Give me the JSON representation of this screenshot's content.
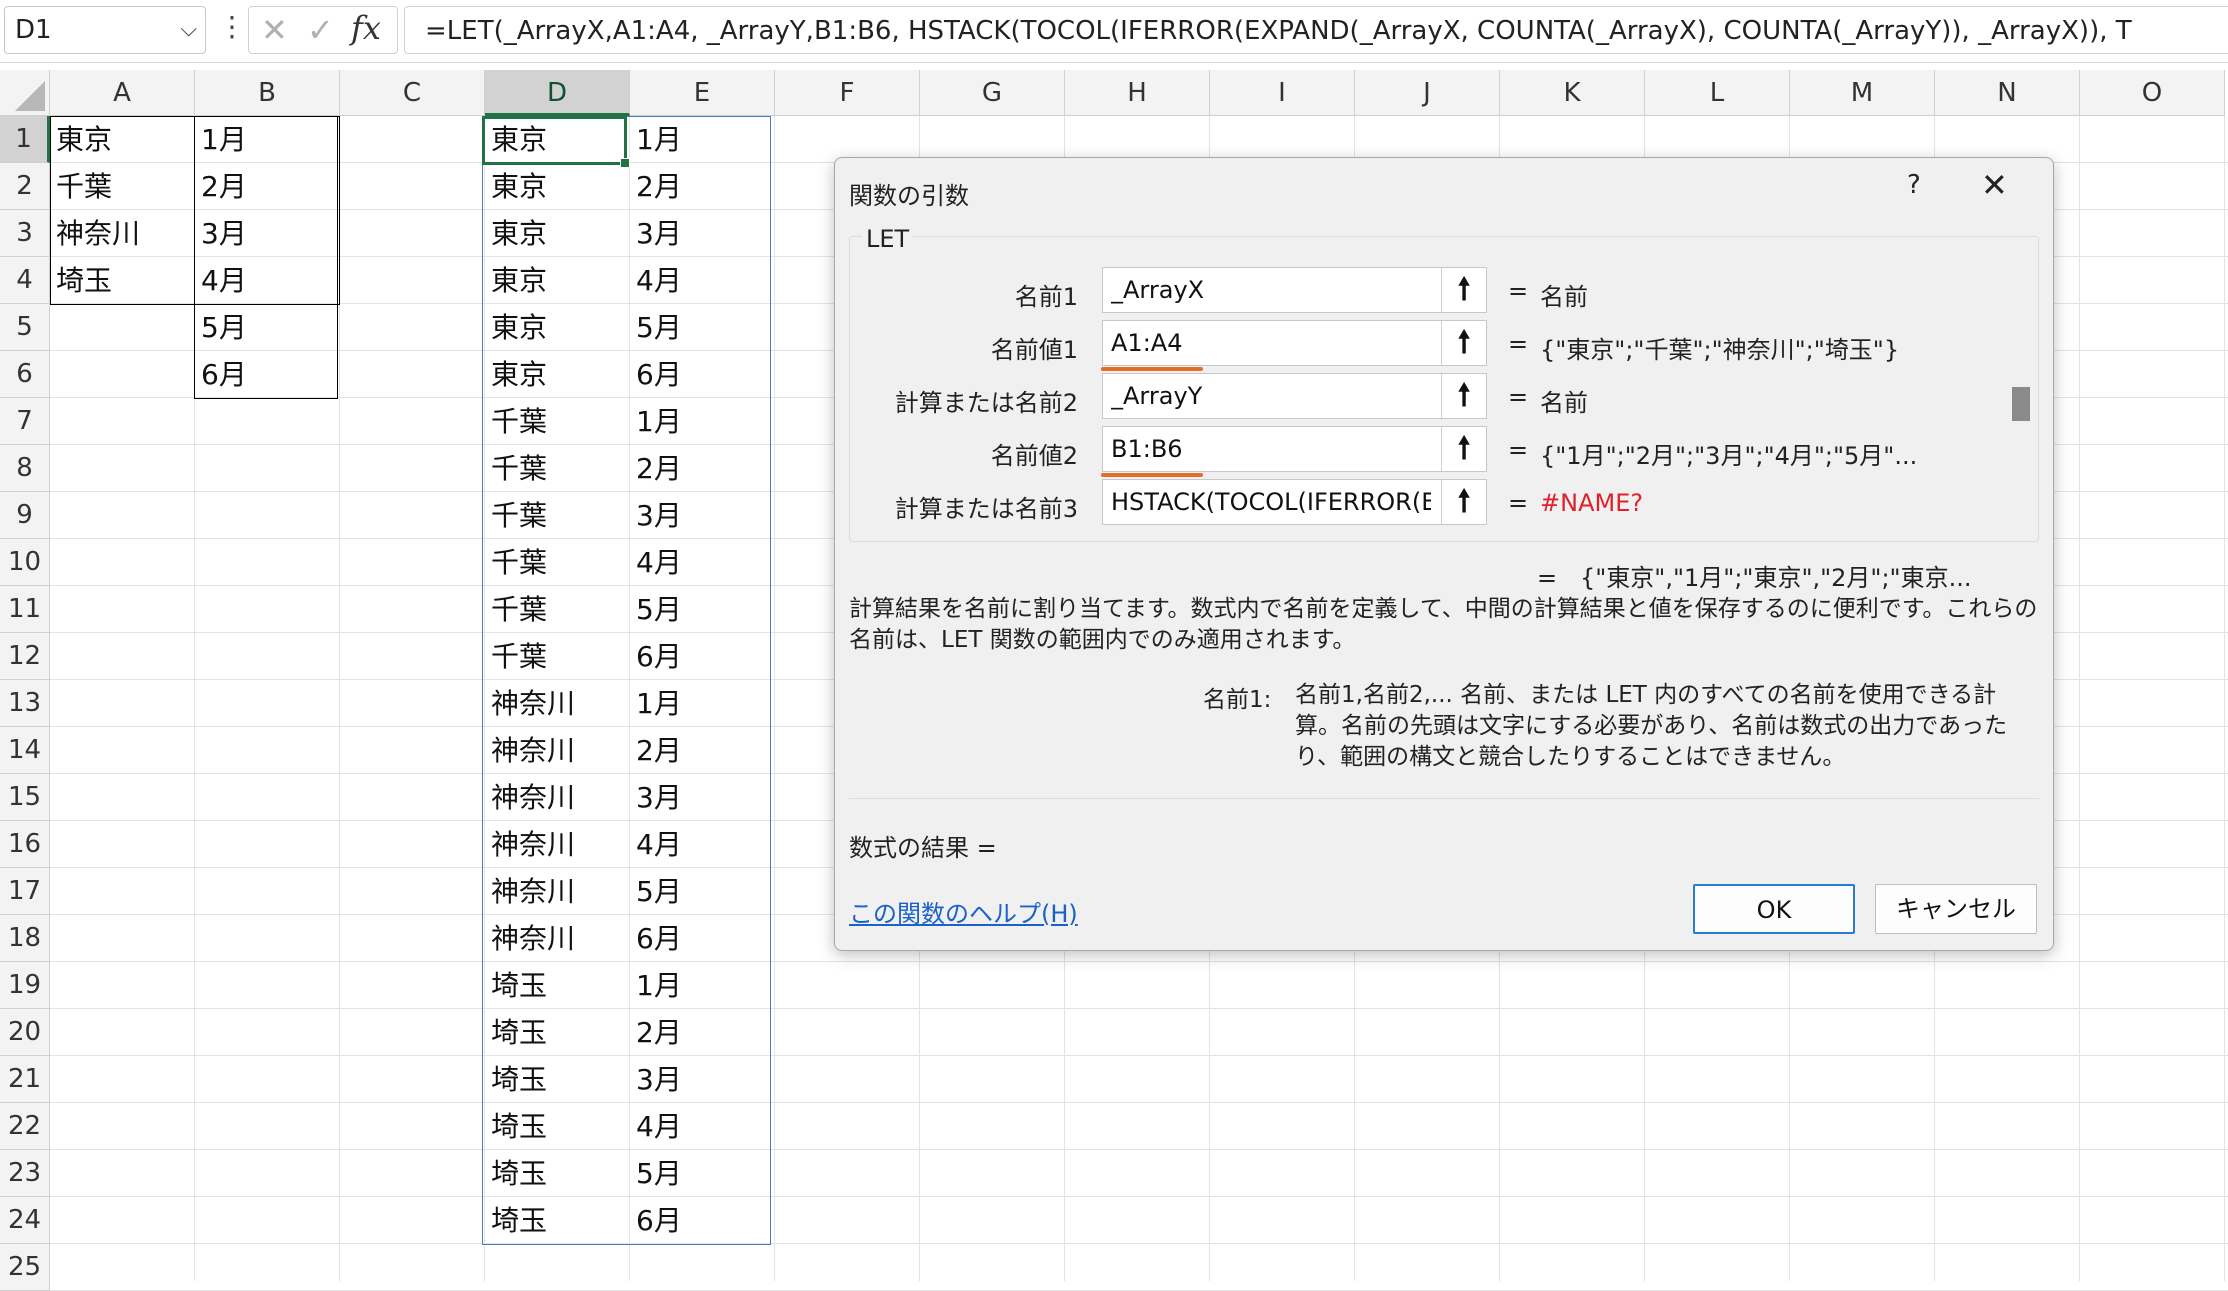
{
  "formula_bar": {
    "name_box": "D1",
    "formula": "=LET(_ArrayX,A1:A4, _ArrayY,B1:B6, HSTACK(TOCOL(IFERROR(EXPAND(_ArrayX, COUNTA(_ArrayX), COUNTA(_ArrayY)), _ArrayX)), T"
  },
  "columns": [
    "A",
    "B",
    "C",
    "D",
    "E",
    "F",
    "G",
    "H",
    "I",
    "J",
    "K",
    "L",
    "M",
    "N",
    "O"
  ],
  "rows": [
    "1",
    "2",
    "3",
    "4",
    "5",
    "6",
    "7",
    "8",
    "9",
    "10",
    "11",
    "12",
    "13",
    "14",
    "15",
    "16",
    "17",
    "18",
    "19",
    "20",
    "21",
    "22",
    "23",
    "24",
    "25"
  ],
  "col_a": [
    "東京",
    "千葉",
    "神奈川",
    "埼玉"
  ],
  "col_b": [
    "1月",
    "2月",
    "3月",
    "4月",
    "5月",
    "6月"
  ],
  "col_d": [
    "東京",
    "東京",
    "東京",
    "東京",
    "東京",
    "東京",
    "千葉",
    "千葉",
    "千葉",
    "千葉",
    "千葉",
    "千葉",
    "神奈川",
    "神奈川",
    "神奈川",
    "神奈川",
    "神奈川",
    "神奈川",
    "埼玉",
    "埼玉",
    "埼玉",
    "埼玉",
    "埼玉",
    "埼玉"
  ],
  "col_e": [
    "1月",
    "2月",
    "3月",
    "4月",
    "5月",
    "6月",
    "1月",
    "2月",
    "3月",
    "4月",
    "5月",
    "6月",
    "1月",
    "2月",
    "3月",
    "4月",
    "5月",
    "6月",
    "1月",
    "2月",
    "3月",
    "4月",
    "5月",
    "6月"
  ],
  "dialog": {
    "title": "関数の引数",
    "help_icon": "?",
    "close_icon": "✕",
    "function_name": "LET",
    "args": [
      {
        "label": "名前1",
        "value": "_ArrayX",
        "eq": "=",
        "result": "名前",
        "error": false
      },
      {
        "label": "名前値1",
        "value": "A1:A4",
        "eq": "=",
        "result": "{\"東京\";\"千葉\";\"神奈川\";\"埼玉\"}",
        "error": false
      },
      {
        "label": "計算または名前2",
        "value": "_ArrayY",
        "eq": "=",
        "result": "名前",
        "error": false
      },
      {
        "label": "名前値2",
        "value": "B1:B6",
        "eq": "=",
        "result": "{\"1月\";\"2月\";\"3月\";\"4月\";\"5月\"...",
        "error": false
      },
      {
        "label": "計算または名前3",
        "value": "HSTACK(TOCOL(IFERROR(EXP",
        "eq": "=",
        "result": "#NAME?",
        "error": true
      }
    ],
    "total_eq": "=",
    "total_result": "{\"東京\",\"1月\";\"東京\",\"2月\";\"東京...",
    "description": "計算結果を名前に割り当てます。数式内で名前を定義して、中間の計算結果と値を保存するのに便利です。これらの名前は、LET 関数の範囲内でのみ適用されます。",
    "arg_desc_label": "名前1:",
    "arg_desc": "名前1,名前2,... 名前、または LET 内のすべての名前を使用できる計算。名前の先頭は文字にする必要があり、名前は数式の出力であったり、範囲の構文と競合したりすることはできません。",
    "result_label": "数式の結果 =",
    "help_link": "この関数のヘルプ(H)",
    "ok": "OK",
    "cancel": "キャンセル"
  }
}
